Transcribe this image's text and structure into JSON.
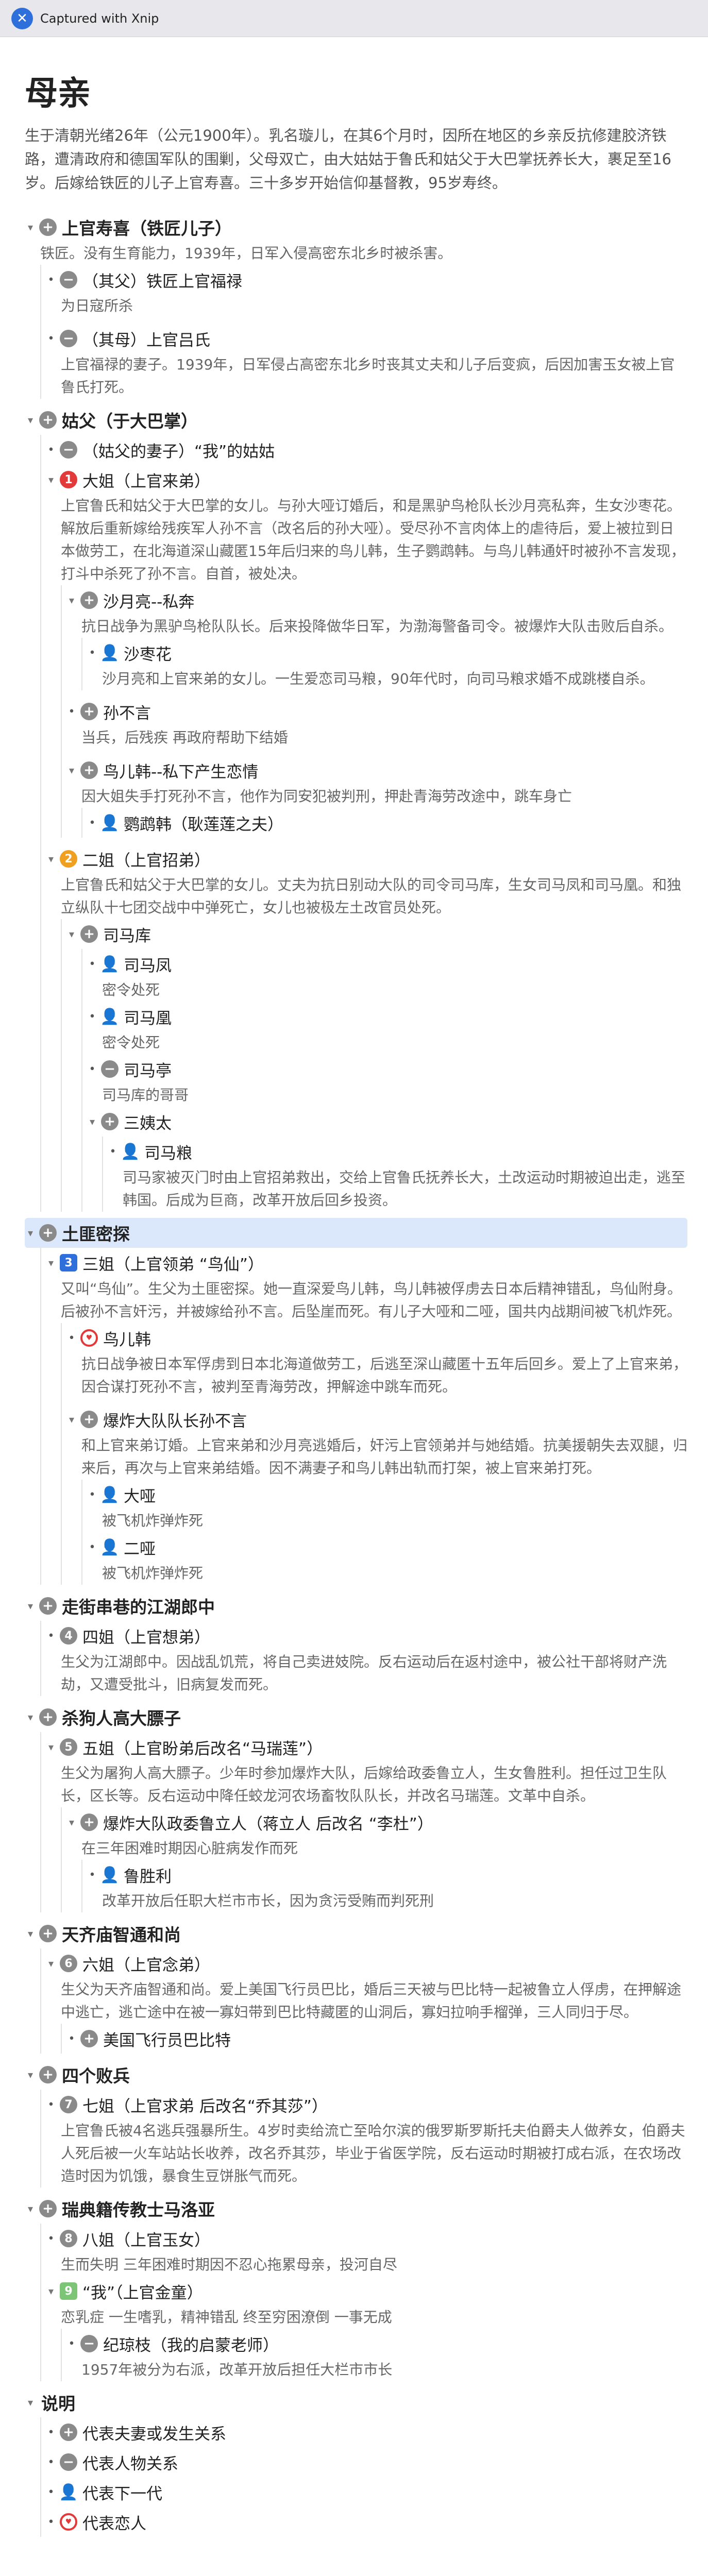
{
  "capture": "Captured with Xnip",
  "title": "母亲",
  "intro": "生于清朝光绪26年（公元1900年）。乳名璇儿，在其6个月时，因所在地区的乡亲反抗修建胶济铁路，遭清政府和德国军队的围剿，父母双亡，由大姑姑于鲁氏和姑父于大巴掌抚养长大，裹足至16岁。后嫁给铁匠的儿子上官寿喜。三十多岁开始信仰基督教，95岁寿终。",
  "t": {
    "a": {
      "label": "上官寿喜（铁匠儿子）",
      "note": "铁匠。没有生育能力，1939年，日军入侵高密东北乡时被杀害。"
    },
    "a1": {
      "label": "（其父）铁匠上官福禄",
      "note": "为日寇所杀"
    },
    "a2": {
      "label": "（其母）上官吕氏",
      "note": "上官福禄的妻子。1939年，日军侵占高密东北乡时丧其丈夫和儿子后变疯，后因加害玉女被上官鲁氏打死。"
    },
    "b": {
      "label": "姑父（于大巴掌）"
    },
    "b1": {
      "label": "（姑父的妻子）“我”的姑姑"
    },
    "c1": {
      "label": "大姐（上官来弟）",
      "num": "1",
      "note": "上官鲁氏和姑父于大巴掌的女儿。与孙大哑订婚后，和是黑驴鸟枪队长沙月亮私奔，生女沙枣花。解放后重新嫁给残疾军人孙不言（改名后的孙大哑）。受尽孙不言肉体上的虐待后，爱上被拉到日本做劳工，在北海道深山藏匿15年后归来的鸟儿韩，生子鹦鹉韩。与鸟儿韩通奸时被孙不言发现，打斗中杀死了孙不言。自首，被处决。"
    },
    "c1a": {
      "label": "沙月亮--私奔",
      "note": "抗日战争为黑驴鸟枪队队长。后来投降做华日军，为渤海警备司令。被爆炸大队击败后自杀。"
    },
    "c1a1": {
      "label": "沙枣花",
      "note": "沙月亮和上官来弟的女儿。一生爱恋司马粮，90年代时，向司马粮求婚不成跳楼自杀。"
    },
    "c1b": {
      "label": "孙不言",
      "note": "当兵，后残疾 再政府帮助下结婚"
    },
    "c1c": {
      "label": "鸟儿韩--私下产生恋情",
      "note": "因大姐失手打死孙不言，他作为同安犯被判刑，押赴青海劳改途中，跳车身亡"
    },
    "c1c1": {
      "label": "鹦鹉韩（耿莲莲之夫）"
    },
    "c2": {
      "label": "二姐（上官招弟）",
      "num": "2",
      "note": "上官鲁氏和姑父于大巴掌的女儿。丈夫为抗日别动大队的司令司马库，生女司马凤和司马凰。和独立纵队十七团交战中中弹死亡，女儿也被极左土改官员处死。"
    },
    "c2a": {
      "label": "司马库"
    },
    "c2a1": {
      "label": "司马凤",
      "note": "密令处死"
    },
    "c2a2": {
      "label": "司马凰",
      "note": "密令处死"
    },
    "c2a3": {
      "label": "司马亭",
      "note": "司马库的哥哥"
    },
    "c2a4": {
      "label": "三姨太"
    },
    "c2a41": {
      "label": "司马粮",
      "note": "司马家被灭门时由上官招弟救出，交给上官鲁氏抚养长大，土改运动时期被迫出走，逃至韩国。后成为巨商，改革开放后回乡投资。"
    },
    "d": {
      "label": "土匪密探"
    },
    "d1": {
      "label": "三姐（上官领弟 “鸟仙”）",
      "num": "3",
      "note": "又叫“鸟仙”。生父为土匪密探。她一直深爱鸟儿韩，鸟儿韩被俘虏去日本后精神错乱，鸟仙附身。后被孙不言奸污，并被嫁给孙不言。后坠崖而死。有儿子大哑和二哑，国共内战期间被飞机炸死。"
    },
    "d1a": {
      "label": "鸟儿韩",
      "note": "抗日战争被日本军俘虏到日本北海道做劳工，后逃至深山藏匿十五年后回乡。爱上了上官来弟，因合谋打死孙不言，被判至青海劳改，押解途中跳车而死。"
    },
    "d1b": {
      "label": "爆炸大队队长孙不言",
      "note": "和上官来弟订婚。上官来弟和沙月亮逃婚后，奸污上官领弟并与她结婚。抗美援朝失去双腿，归来后，再次与上官来弟结婚。因不满妻子和鸟儿韩出轨而打架，被上官来弟打死。"
    },
    "d1b1": {
      "label": "大哑",
      "note": "被飞机炸弹炸死"
    },
    "d1b2": {
      "label": "二哑",
      "note": "被飞机炸弹炸死"
    },
    "e": {
      "label": "走街串巷的江湖郎中"
    },
    "e1": {
      "label": "四姐（上官想弟）",
      "num": "4",
      "note": "生父为江湖郎中。因战乱饥荒，将自己卖进妓院。反右运动后在返村途中，被公社干部将财产洗劫，又遭受批斗，旧病复发而死。"
    },
    "f": {
      "label": "杀狗人高大膘子"
    },
    "f1": {
      "label": "五姐（上官盼弟后改名“马瑞莲”）",
      "num": "5",
      "note": "生父为屠狗人高大膘子。少年时参加爆炸大队，后嫁给政委鲁立人，生女鲁胜利。担任过卫生队长，区长等。反右运动中降任蛟龙河农场畜牧队队长，并改名马瑞莲。文革中自杀。"
    },
    "f1a": {
      "label": "爆炸大队政委鲁立人（蒋立人 后改名 “李杜”）",
      "note": "在三年困难时期因心脏病发作而死"
    },
    "f1a1": {
      "label": "鲁胜利",
      "note": "改革开放后任职大栏市市长，因为贪污受贿而判死刑"
    },
    "g": {
      "label": "天齐庙智通和尚"
    },
    "g1": {
      "label": "六姐（上官念弟）",
      "num": "6",
      "note": "生父为天齐庙智通和尚。爱上美国飞行员巴比，婚后三天被与巴比特一起被鲁立人俘虏，在押解途中逃亡，逃亡途中在被一寡妇带到巴比特藏匿的山洞后，寡妇拉响手榴弹，三人同归于尽。"
    },
    "g1a": {
      "label": "美国飞行员巴比特"
    },
    "h": {
      "label": "四个败兵"
    },
    "h1": {
      "label": "七姐（上官求弟 后改名“乔其莎”）",
      "num": "7",
      "note": "上官鲁氏被4名逃兵强暴所生。4岁时卖给流亡至哈尔滨的俄罗斯罗斯托夫伯爵夫人做养女，伯爵夫人死后被一火车站站长收养，改名乔其莎，毕业于省医学院，反右运动时期被打成右派，在农场改造时因为饥饿，暴食生豆饼胀气而死。"
    },
    "i": {
      "label": "瑞典籍传教士马洛亚"
    },
    "i1": {
      "label": "八姐（上官玉女）",
      "num": "8",
      "note": "生而失明 三年困难时期因不忍心拖累母亲，投河自尽"
    },
    "i2": {
      "label": "“我”（上官金童）",
      "num": "9",
      "note": "恋乳症 一生嗜乳，精神错乱 终至穷困潦倒 一事无成"
    },
    "i2a": {
      "label": "纪琼枝（我的启蒙老师）",
      "note": "1957年被分为右派，改革开放后担任大栏市市长"
    },
    "j": {
      "label": "说明"
    },
    "j1": {
      "label": "代表夫妻或发生关系"
    },
    "j2": {
      "label": "代表人物关系"
    },
    "j3": {
      "label": "代表下一代"
    },
    "j4": {
      "label": "代表恋人"
    }
  },
  "colors": {
    "accent": "#2f6fdc",
    "red": "#e23a3a",
    "green": "#1f9a74",
    "highlight": "#dbe8fb"
  }
}
